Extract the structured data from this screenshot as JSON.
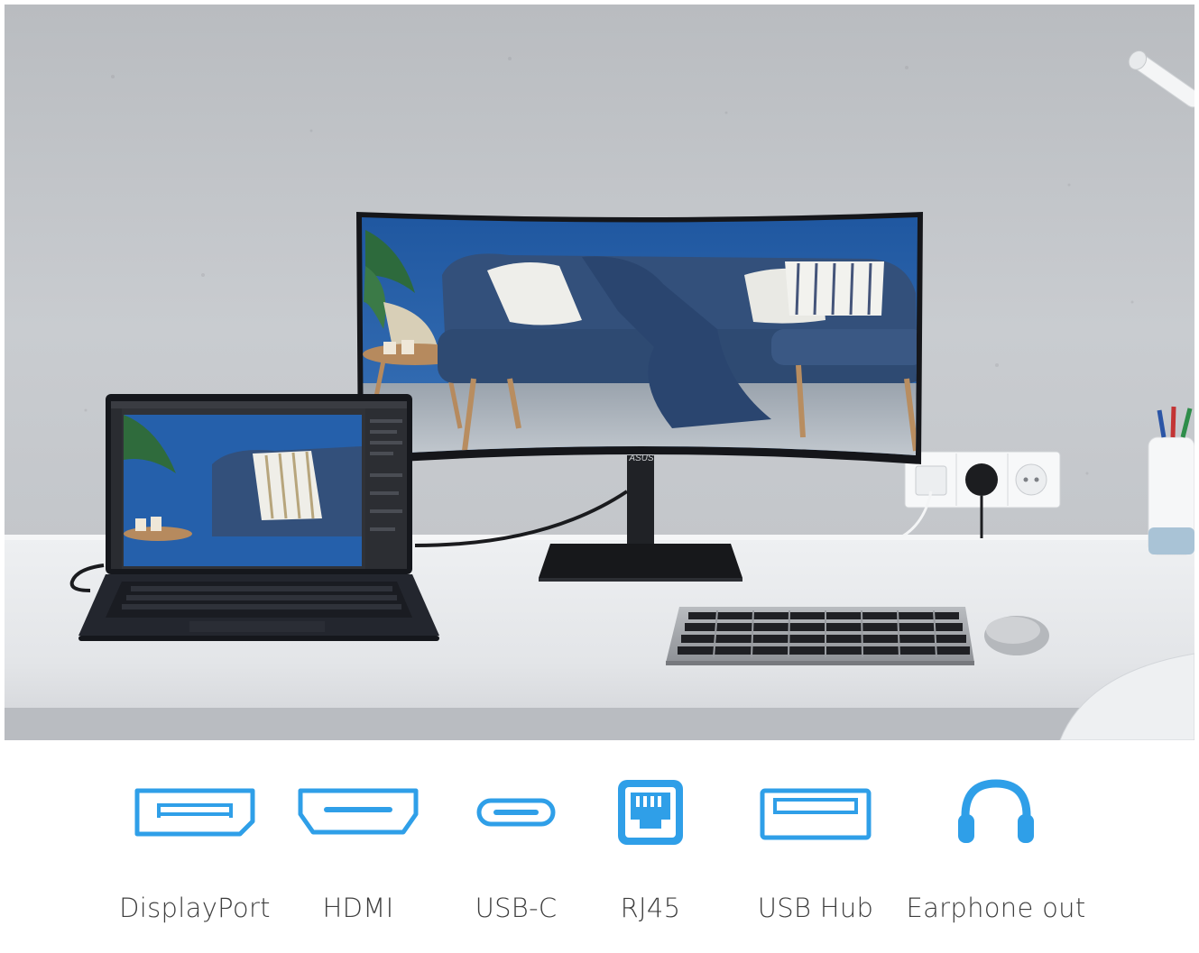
{
  "scene": {
    "monitor_logo": "ASUS",
    "colors": {
      "wall": "#c4c7cb",
      "desk": "#e7e9ec",
      "sofa_blue": "#34507a",
      "screen_wall": "#2f62a3",
      "device_black": "#1d1f24"
    }
  },
  "ports": [
    {
      "label": "DisplayPort",
      "icon": "displayport-icon"
    },
    {
      "label": "HDMI",
      "icon": "hdmi-icon"
    },
    {
      "label": "USB-C",
      "icon": "usb-c-icon"
    },
    {
      "label": "RJ45",
      "icon": "rj45-icon"
    },
    {
      "label": "USB Hub",
      "icon": "usb-hub-icon"
    },
    {
      "label": "Earphone out",
      "icon": "headphone-icon"
    }
  ],
  "accent_color": "#2f9fe8"
}
